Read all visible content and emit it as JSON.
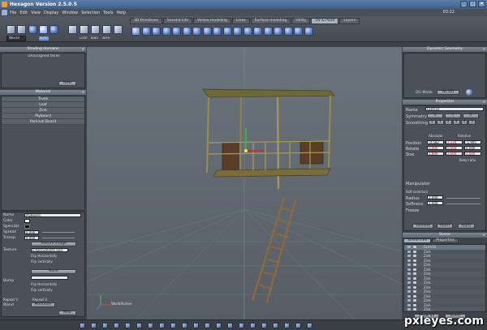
{
  "window": {
    "title": "Hexagon Version 2.5.0.5",
    "clock": "03:22",
    "controls": [
      "_",
      "□",
      "×"
    ]
  },
  "menu": [
    "File",
    "Edit",
    "View",
    "Display",
    "Window",
    "Selection",
    "Tools",
    "Help"
  ],
  "toolbar": {
    "tabs": [
      {
        "label": "3D Primitives",
        "active": false
      },
      {
        "label": "Second Life",
        "active": false
      },
      {
        "label": "Vertex modeling",
        "active": false
      },
      {
        "label": "Lines",
        "active": false
      },
      {
        "label": "Surface modeling",
        "active": false
      },
      {
        "label": "Utility",
        "active": false
      },
      {
        "label": "UV & Paint",
        "active": true
      },
      {
        "label": "Layers",
        "active": false
      }
    ],
    "space_select": "World",
    "mode_labels": [
      "LOOP",
      "RING",
      "WITH"
    ],
    "tool_icons": [
      "uv-sphere-icon",
      "uv-cube-icon",
      "uv-cylinder-icon",
      "uv-plane-icon",
      "uv-box-icon",
      "paint-brush-icon",
      "smudge-icon",
      "clone-icon",
      "fill-icon",
      "wand-icon",
      "eraser-icon",
      "hand-icon",
      "pin-icon",
      "blur-icon",
      "picker-icon",
      "magnet-icon",
      "smooth-icon",
      "scale-icon"
    ]
  },
  "left_panel": {
    "shading_header": "Shading domains",
    "shading_items": [
      "Unassigned faces"
    ],
    "new_button": "New",
    "material_header": "Material",
    "materials": [
      "Trunk",
      "Leaf",
      "Zink",
      "Plyboard",
      "Parkival Board"
    ],
    "props": {
      "name_label": "Name",
      "name_value": "PlyBoard",
      "color_label": "Color",
      "specular_label": "Specular",
      "spread_label": "Spread",
      "spread_value": "0.000",
      "transp_label": "Transp.",
      "transp_value": "0.000",
      "texture_label": "Texture",
      "texture_type": "Texture image",
      "texture_path": "E:\\Documents and",
      "flip_h": "Flip Horizontally",
      "flip_v": "Flip vertically",
      "bump_label": "Bump",
      "bump_type": "None",
      "repeat_v": "Repeat V",
      "repeat_u": "Repeat U",
      "blend_label": "Blend",
      "blend_value": "Modulate",
      "new_button": "New"
    }
  },
  "viewport": {
    "label": "Perspective view",
    "axis_label": "World/Scene"
  },
  "right_panel": {
    "dyn_header": "Dynamic Geometry",
    "dyn_mode_label": "DG Mode",
    "dyn_mode_value": "No DG",
    "props_header": "Properties",
    "name_label": "Name",
    "name_value": "Form10",
    "symmetry_label": "Symmetry",
    "symmetry_opts": [
      "X",
      "Y",
      "Z"
    ],
    "smoothing_label": "Smoothing",
    "smoothing_levels": [
      "0",
      "1",
      "2",
      "3",
      "4",
      "5"
    ],
    "absolute": "Absolute",
    "relative": "Relative",
    "position_label": "Position",
    "position": [
      "-0.582",
      "2.234",
      "-1.905"
    ],
    "rotate_label": "Rotate",
    "rotate": [
      "0.000",
      "0.000",
      "0.000"
    ],
    "size_label": "Size",
    "size": [
      "1.899",
      "2.000",
      "1.000"
    ],
    "keep_ratio": "Keep ratio",
    "manipulator": "Manipulator",
    "soft_selection": "Soft selection",
    "radius_label": "Radius",
    "radius_value": "1.000",
    "softness_label": "Softness",
    "softness_value": "1.000",
    "freeze_label": "Freeze",
    "buttons": [
      "Validate",
      "Abort",
      "Apply"
    ],
    "scene_header": "Scene",
    "scene_tabs": [
      "Scene tree",
      "Properties"
    ],
    "scene_items": [
      "Form10",
      "Zink",
      "Zink",
      "Zink",
      "Zink",
      "Zink",
      "Zink",
      "Zink",
      "Zink",
      "Zink",
      "Zink",
      "Zink",
      "Zink",
      "Zink",
      "Zink"
    ],
    "scene_buttons": [
      "Show all",
      "Select"
    ]
  },
  "watermark": "pxleyes.com",
  "colors": {
    "accent": "#4a6fae",
    "viewport": "#616a73",
    "panel": "#3f444b",
    "header": "#6e7884"
  }
}
